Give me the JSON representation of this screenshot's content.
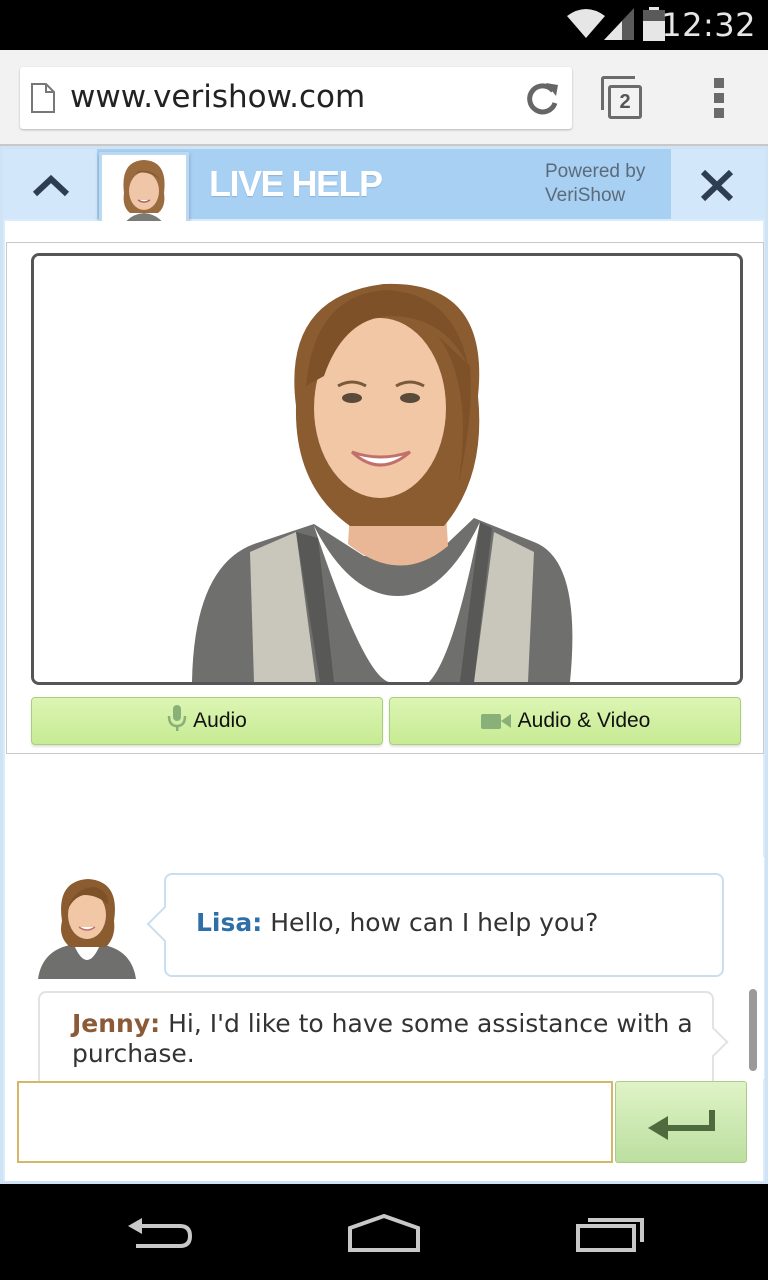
{
  "status_bar": {
    "time": "12:32"
  },
  "browser": {
    "url": "www.verishow.com",
    "tab_count": "2"
  },
  "widget": {
    "title": "LIVE HELP",
    "powered_line1": "Powered by",
    "powered_line2": "VeriShow"
  },
  "call_buttons": {
    "audio": "Audio",
    "audio_video": "Audio & Video"
  },
  "chat": {
    "messages": [
      {
        "sender": "Lisa:",
        "text": "Hello, how can I help you?"
      },
      {
        "sender": "Jenny:",
        "text": "Hi, I'd like to have some assistance with a purchase."
      }
    ],
    "input_value": ""
  },
  "colors": {
    "header_blue": "#a8d0f3",
    "button_green": "#c7eb93",
    "lisa_name": "#2f6fa8",
    "jenny_name": "#8b5a36"
  }
}
